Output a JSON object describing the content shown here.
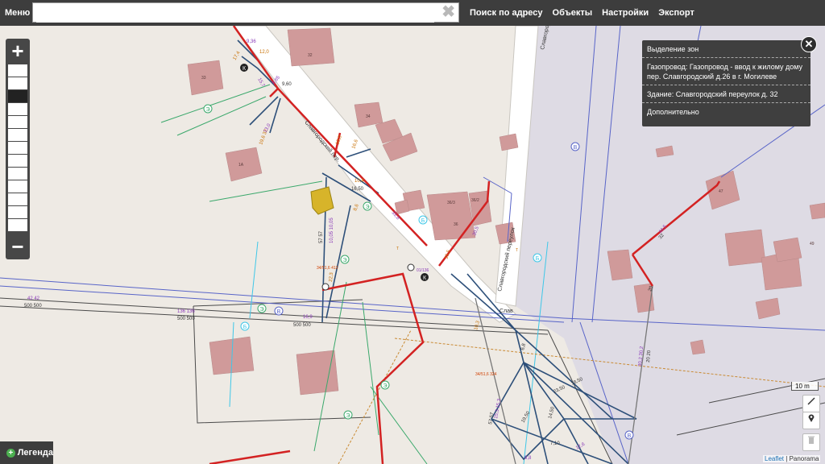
{
  "topbar": {
    "menu_label": "Меню",
    "search_value": "",
    "search_clear_symbol": "✖",
    "nav": [
      "Поиск по адресу",
      "Объекты",
      "Настройки",
      "Экспорт"
    ]
  },
  "popup": {
    "title": "Выделение зон",
    "gas_line": "Газопровод: Газопровод - ввод к жилому дому пер. Славгородский д.26 в г. Могилеве",
    "building": "Здание: Славгородский переулок д. 32",
    "extra": "Дополнительно",
    "close_symbol": "✕"
  },
  "scale_label": "10 m",
  "legend_label": "Легенда",
  "attribution": {
    "leaflet": "Leaflet",
    "separator": " | ",
    "panorama": "Panorama"
  },
  "colors": {
    "topbar": "#3d3d3d",
    "gas_red": "#d32222",
    "net_blue": "#2d4f79",
    "net_green": "#3aa86b",
    "label_purple": "#8a3ab8"
  },
  "map": {
    "streets": [
      "Славгородский пер.",
      "Славгородский переулок",
      "Слав"
    ],
    "buildings": [
      "32",
      "33",
      "34",
      "1А",
      "36/3",
      "36/2",
      "36",
      "47",
      "49"
    ],
    "line_labels": [
      "19,6 32",
      "13,0",
      "15,7",
      "8,65",
      "9,60",
      "12,0",
      "17,4",
      "9,36",
      "10,0",
      "16,6",
      "10,4",
      "16,50",
      "8,6",
      "33,8",
      "30,5",
      "15,5",
      "44,5",
      "32",
      "20",
      "10,05 10,05",
      "57 57",
      "22,3",
      "16,9",
      "500 500",
      "136 136",
      "42 42",
      "10,3",
      "6,8",
      "18,50",
      "23,50",
      "19,50",
      "14,50",
      "7,10",
      "12,6",
      "15,3 15,3",
      "57 57",
      "30,2 30,2",
      "20 20",
      "8,8"
    ],
    "marker_letters": [
      "Б",
      "Э",
      "К",
      "В"
    ]
  }
}
